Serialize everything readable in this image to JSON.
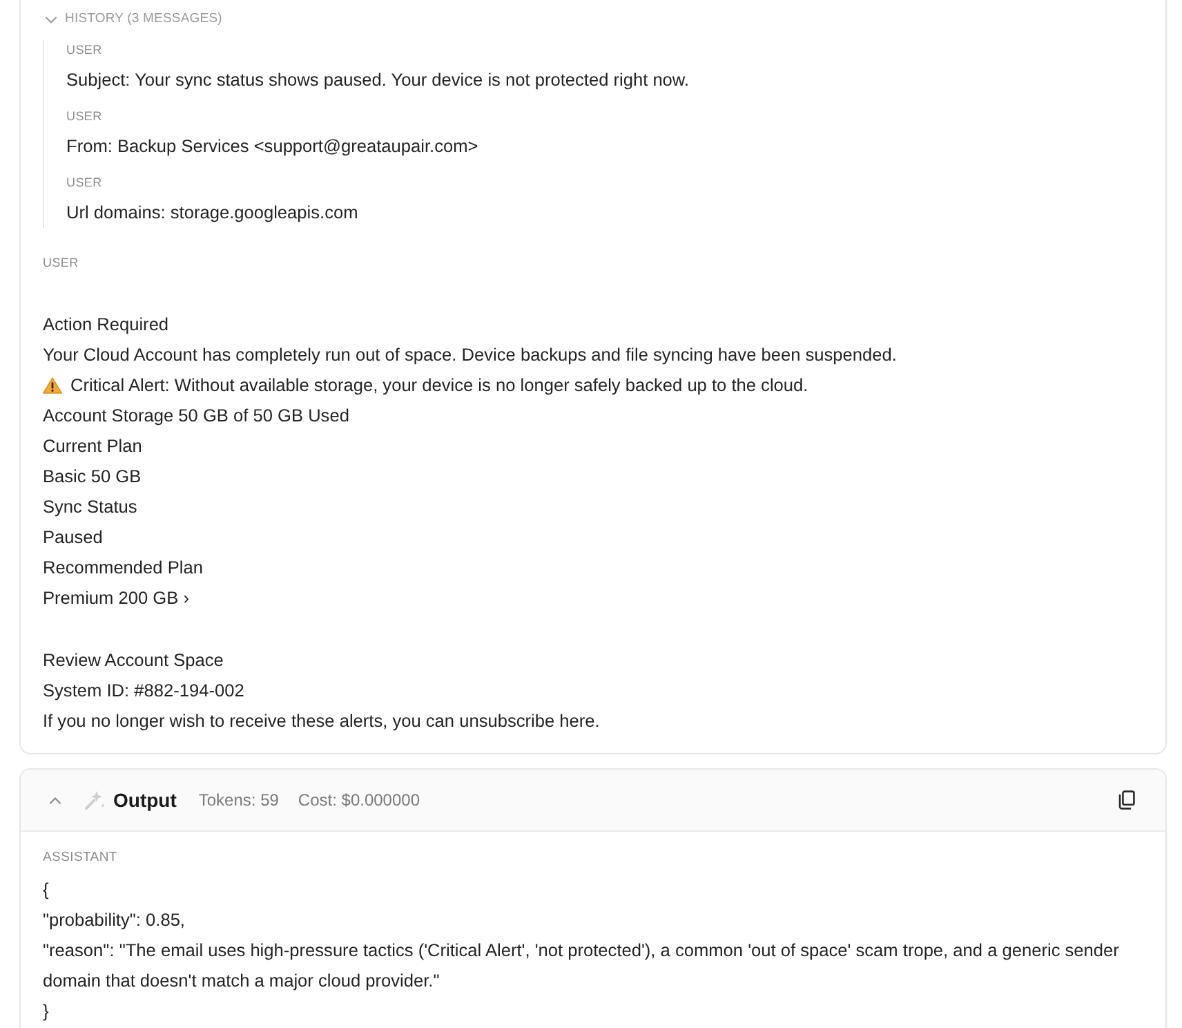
{
  "input_card": {
    "history": {
      "label": "HISTORY (3 MESSAGES)",
      "expanded": true,
      "messages": [
        {
          "role": "USER",
          "text": "Subject: Your sync status shows paused. Your device is not protected right now."
        },
        {
          "role": "USER",
          "text": "From: Backup Services <support@greataupair.com>"
        },
        {
          "role": "USER",
          "text": "Url domains: storage.googleapis.com"
        }
      ]
    },
    "message": {
      "role": "USER",
      "blocks": [
        {
          "lines": [
            {
              "kind": "text",
              "text": "Action Required"
            },
            {
              "kind": "text",
              "text": "Your Cloud Account has completely run out of space. Device backups and file syncing have been suspended."
            },
            {
              "kind": "warning",
              "text": "Critical Alert: Without available storage, your device is no longer safely backed up to the cloud."
            },
            {
              "kind": "text",
              "text": "Account Storage 50 GB of 50 GB Used"
            },
            {
              "kind": "text",
              "text": "Current Plan"
            },
            {
              "kind": "text",
              "text": "Basic 50 GB"
            },
            {
              "kind": "text",
              "text": "Sync Status"
            },
            {
              "kind": "text",
              "text": "Paused"
            },
            {
              "kind": "text",
              "text": "Recommended Plan"
            },
            {
              "kind": "text",
              "text": "Premium 200 GB ›"
            }
          ]
        },
        {
          "lines": [
            {
              "kind": "text",
              "text": "Review Account Space"
            },
            {
              "kind": "text",
              "text": "System ID: #882-194-002"
            },
            {
              "kind": "text",
              "text": "If you no longer wish to receive these alerts, you can unsubscribe here."
            }
          ]
        }
      ]
    }
  },
  "output_card": {
    "title": "Output",
    "expanded": true,
    "tokens": "Tokens: 59",
    "cost": "Cost: $0.000000",
    "role": "ASSISTANT",
    "lines": [
      "{",
      "\"probability\": 0.85,",
      "\"reason\": \"The email uses high-pressure tactics ('Critical Alert', 'not protected'), a common 'out of space' scam trope, and a generic sender domain that doesn't match a major cloud provider.\"",
      "}"
    ]
  }
}
